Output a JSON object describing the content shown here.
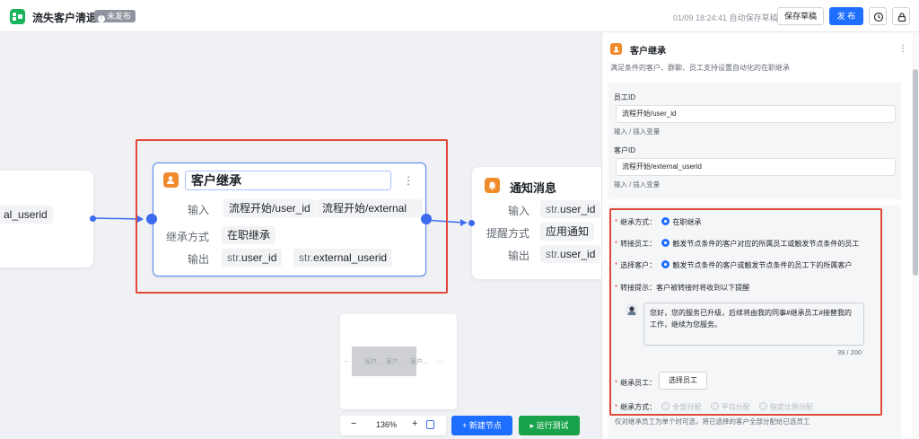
{
  "header": {
    "title": "流失客户清退",
    "status": "未发布",
    "autosave": "01/09 18:24:41 自动保存草稿",
    "save_label": "保存草稿",
    "publish_label": "发 布"
  },
  "canvas": {
    "left_node": {
      "chip": "al_userid"
    },
    "main_node": {
      "title": "客户继承",
      "rows": [
        {
          "label": "输入",
          "chips": [
            "流程开始/user_id",
            "流程开始/external"
          ]
        },
        {
          "label": "继承方式",
          "chips": [
            "在职继承"
          ]
        },
        {
          "label": "输出",
          "chips": [
            [
              "str.",
              "user_id"
            ],
            [
              "str.",
              "external_userid"
            ]
          ]
        }
      ]
    },
    "notify_node": {
      "title": "通知消息",
      "rows": [
        {
          "label": "输入",
          "prefix": "str.",
          "value": "user_id"
        },
        {
          "label": "提醒方式",
          "prefix": "",
          "value": "应用通知"
        },
        {
          "label": "输出",
          "prefix": "str.",
          "value": "user_id"
        }
      ]
    },
    "minimap": {
      "labels": [
        "客户...",
        "客户...",
        "客户...",
        "..."
      ]
    },
    "zoom": {
      "minus": "−",
      "level": "136%",
      "plus": "+"
    },
    "new_node_label": "+ 新建节点",
    "run_test_label": "▸ 运行测试"
  },
  "panel": {
    "title": "客户继承",
    "desc": "满足条件的客户、群聊、员工支持设置自动化的在职继承",
    "employee_id": {
      "label": "员工ID",
      "value": "流程开始/user_id",
      "hint": "输入 / 插入变量"
    },
    "customer_id": {
      "label": "客户ID",
      "value": "流程开始/external_userid",
      "hint": "输入 / 插入变量"
    },
    "inherit_mode": {
      "label": "继承方式：",
      "option": "在职继承"
    },
    "transfer_employee": {
      "label": "转接员工：",
      "option": "触发节点条件的客户对应的所属员工或触发节点条件的员工"
    },
    "select_customer": {
      "label": "选择客户：",
      "option": "触发节点条件的客户或触发节点条件的员工下的所属客户"
    },
    "transfer_tip": {
      "label": "转接提示：",
      "desc": "客户被转接时将收到以下提醒",
      "message": "您好，您的服务已升级，后续将由我的同事#继承员工#接替我的工作，继续为您服务。",
      "count": "39 / 200"
    },
    "inherit_employee": {
      "label": "继承员工：",
      "button": "选择员工"
    },
    "inherit_type": {
      "label": "继承方式：",
      "options": [
        "全部分配",
        "平均分配",
        "指定比例分配"
      ]
    },
    "footnote": "仅对继承员工为单个时可选，将已选择的客户全部分配给已选员工"
  }
}
